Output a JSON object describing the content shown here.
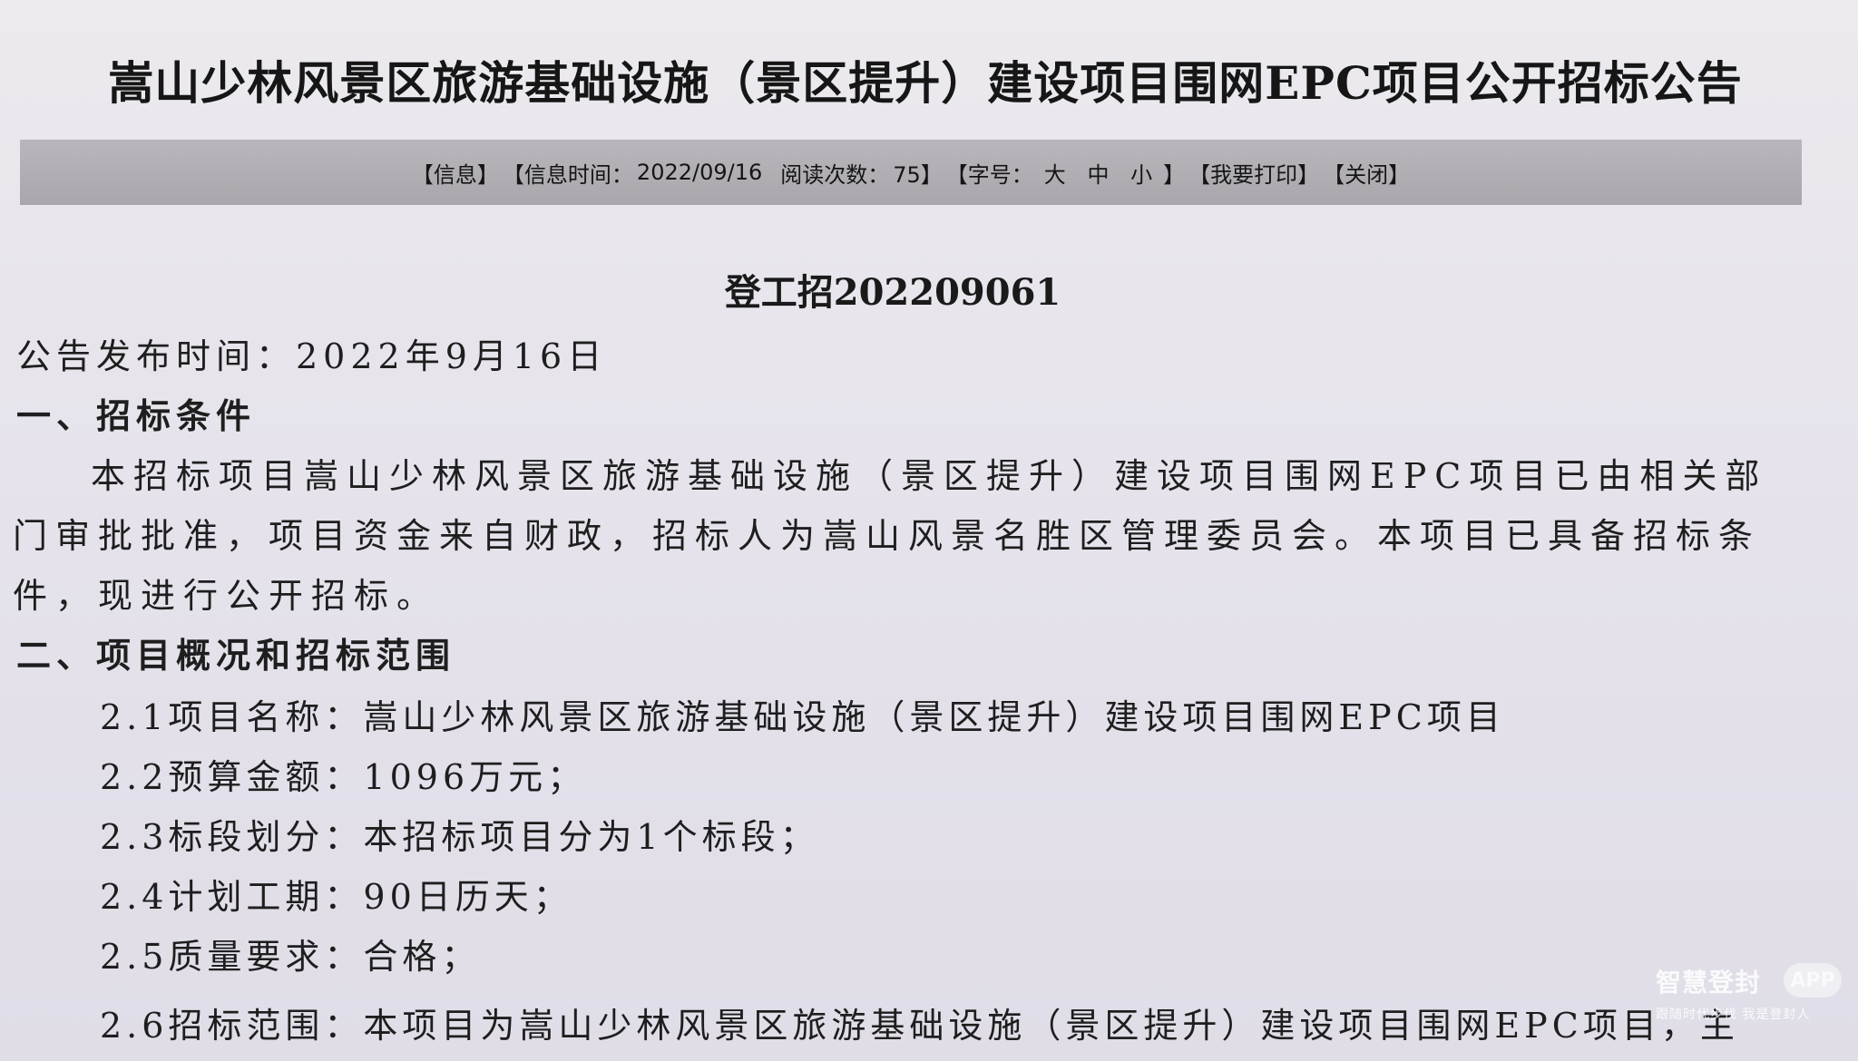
{
  "title": "嵩山少林风景区旅游基础设施（景区提升）建设项目围网EPC项目公开招标公告",
  "info_bar": {
    "info": "【信息】",
    "time_label": "【信息时间：",
    "time_value": "2022/09/16",
    "read_label": "阅读次数：",
    "read_value": "75】",
    "font_size_label": "【字号：",
    "size_large": "大",
    "size_medium": "中",
    "size_small": "小",
    "font_size_close": "】",
    "print": "【我要打印】",
    "close": "【关闭】"
  },
  "doc_number": "登工招202209061",
  "publish_time": "公告发布时间：2022年9月16日",
  "section1": {
    "heading": "一、招标条件",
    "paragraph": "本招标项目嵩山少林风景区旅游基础设施（景区提升）建设项目围网EPC项目已由相关部门审批批准，项目资金来自财政，招标人为嵩山风景名胜区管理委员会。本项目已具备招标条件，现进行公开招标。"
  },
  "section2": {
    "heading": "二、项目概况和招标范围",
    "items": [
      "2.1项目名称：嵩山少林风景区旅游基础设施（景区提升）建设项目围网EPC项目",
      "2.2预算金额：1096万元；",
      "2.3标段划分：本招标项目分为1个标段；",
      "2.4计划工期：90日历天；",
      "2.5质量要求：合格；",
      "2.6招标范围：本项目为嵩山少林风景区旅游基础设施（景区提升）建设项目围网EPC项目，主"
    ]
  },
  "watermark": {
    "logo": "智慧登封",
    "badge": "APP",
    "slogan": "跟随时代步伐 我是登封人"
  }
}
